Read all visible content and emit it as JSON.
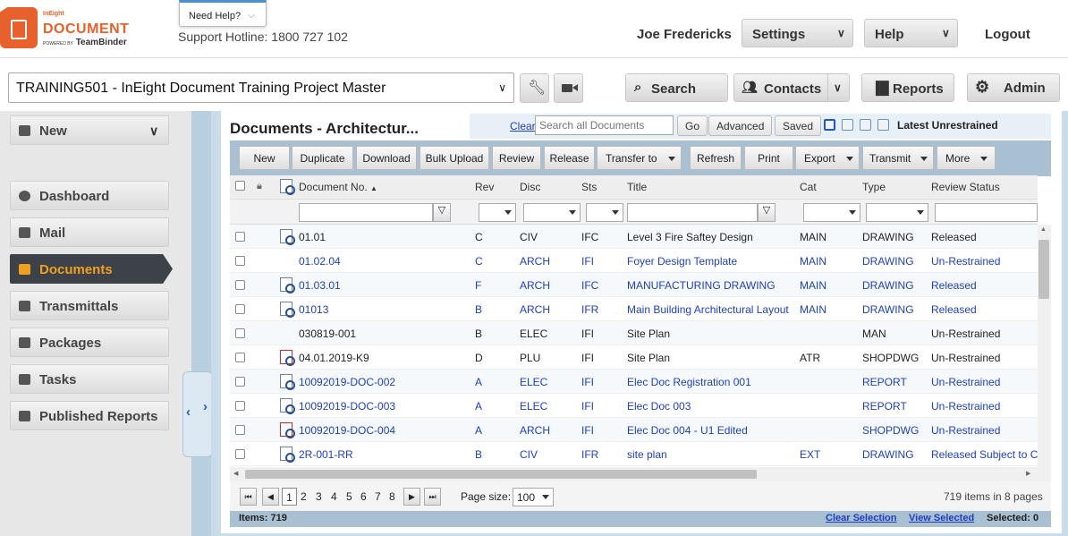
{
  "brand": {
    "ineight": "InEight",
    "product": "DOCUMENT",
    "powered": "POWERED BY",
    "teambinder": "TeamBinder"
  },
  "help": {
    "label": "Need Help?",
    "hotline": "Support Hotline: 1800 727 102"
  },
  "user": {
    "name": "Joe Fredericks",
    "settings": "Settings",
    "help": "Help",
    "logout": "Logout"
  },
  "project": {
    "selected": "TRAINING501 - InEight Document Training Project Master"
  },
  "topnav": {
    "search": "Search",
    "contacts": "Contacts",
    "reports": "Reports",
    "admin": "Admin"
  },
  "sidebar": {
    "new": "New",
    "items": [
      {
        "label": "Dashboard",
        "icon": "dashboard-icon"
      },
      {
        "label": "Mail",
        "icon": "mail-icon"
      },
      {
        "label": "Documents",
        "icon": "documents-icon",
        "active": true
      },
      {
        "label": "Transmittals",
        "icon": "transmittals-icon"
      },
      {
        "label": "Packages",
        "icon": "packages-icon"
      },
      {
        "label": "Tasks",
        "icon": "tasks-icon"
      },
      {
        "label": "Published Reports",
        "icon": "reports-icon"
      }
    ]
  },
  "page": {
    "title": "Documents - Architectur..."
  },
  "search": {
    "clear": "Clear",
    "placeholder": "Search all Documents",
    "go": "Go",
    "advanced": "Advanced",
    "saved": "Saved",
    "filter_label": "Latest Unrestrained"
  },
  "toolbar": {
    "new": "New",
    "duplicate": "Duplicate",
    "download": "Download",
    "bulk_upload": "Bulk Upload",
    "review": "Review",
    "release": "Release",
    "transfer_to": "Transfer to",
    "refresh": "Refresh",
    "print": "Print",
    "export": "Export",
    "transmit": "Transmit",
    "more": "More"
  },
  "grid": {
    "columns": {
      "doc_no": "Document No.",
      "rev": "Rev",
      "disc": "Disc",
      "sts": "Sts",
      "title": "Title",
      "cat": "Cat",
      "type": "Type",
      "review_status": "Review Status"
    },
    "rows": [
      {
        "doc_no": "01.01",
        "rev": "C",
        "disc": "CIV",
        "sts": "IFC",
        "title": "Level 3 Fire Saftey Design",
        "cat": "MAIN",
        "type": "DRAWING",
        "review_status": "Released",
        "blue": false,
        "icon": true,
        "red": false
      },
      {
        "doc_no": "01.02.04",
        "rev": "C",
        "disc": "ARCH",
        "sts": "IFI",
        "title": "Foyer Design Template",
        "cat": "MAIN",
        "type": "DRAWING",
        "review_status": "Un-Restrained",
        "blue": true,
        "icon": false,
        "red": false
      },
      {
        "doc_no": "01.03.01",
        "rev": "F",
        "disc": "ARCH",
        "sts": "IFC",
        "title": "MANUFACTURING DRAWING",
        "cat": "MAIN",
        "type": "DRAWING",
        "review_status": "Released",
        "blue": true,
        "icon": true,
        "red": false
      },
      {
        "doc_no": "01013",
        "rev": "B",
        "disc": "ARCH",
        "sts": "IFR",
        "title": "Main Building Architectural Layout",
        "cat": "MAIN",
        "type": "DRAWING",
        "review_status": "Released",
        "blue": true,
        "icon": true,
        "red": false
      },
      {
        "doc_no": "030819-001",
        "rev": "B",
        "disc": "ELEC",
        "sts": "IFI",
        "title": "Site Plan",
        "cat": "",
        "type": "MAN",
        "review_status": "Un-Restrained",
        "blue": false,
        "icon": false,
        "red": false
      },
      {
        "doc_no": "04.01.2019-K9",
        "rev": "D",
        "disc": "PLU",
        "sts": "IFI",
        "title": "Site Plan",
        "cat": "ATR",
        "type": "SHOPDWG",
        "review_status": "Un-Restrained",
        "blue": false,
        "icon": true,
        "red": true
      },
      {
        "doc_no": "10092019-DOC-002",
        "rev": "A",
        "disc": "ELEC",
        "sts": "IFI",
        "title": "Elec Doc Registration 001",
        "cat": "",
        "type": "REPORT",
        "review_status": "Un-Restrained",
        "blue": true,
        "icon": true,
        "red": false
      },
      {
        "doc_no": "10092019-DOC-003",
        "rev": "A",
        "disc": "ELEC",
        "sts": "IFI",
        "title": "Elec Doc 003",
        "cat": "",
        "type": "REPORT",
        "review_status": "Un-Restrained",
        "blue": true,
        "icon": true,
        "red": false
      },
      {
        "doc_no": "10092019-DOC-004",
        "rev": "A",
        "disc": "ARCH",
        "sts": "IFI",
        "title": "Elec Doc 004 - U1 Edited",
        "cat": "",
        "type": "SHOPDWG",
        "review_status": "Un-Restrained",
        "blue": true,
        "icon": true,
        "red": true
      },
      {
        "doc_no": "2R-001-RR",
        "rev": "B",
        "disc": "CIV",
        "sts": "IFR",
        "title": "site plan",
        "cat": "EXT",
        "type": "DRAWING",
        "review_status": "Released Subject to C",
        "blue": true,
        "icon": true,
        "red": false
      }
    ]
  },
  "pager": {
    "pages": [
      "1",
      "2",
      "3",
      "4",
      "5",
      "6",
      "7",
      "8"
    ],
    "page_size_label": "Page size:",
    "page_size": "100",
    "summary": "719 items in 8 pages"
  },
  "footer": {
    "items": "Items: 719",
    "clear_selection": "Clear Selection",
    "view_selected": "View Selected",
    "selected": "Selected: 0"
  }
}
